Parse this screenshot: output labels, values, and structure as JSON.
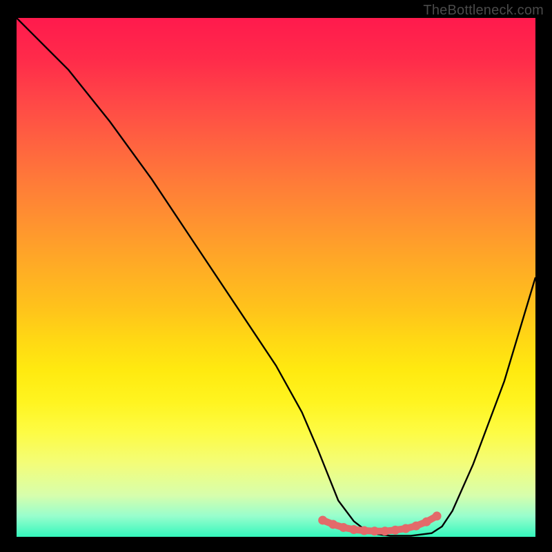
{
  "attribution": "TheBottleneck.com",
  "chart_data": {
    "type": "line",
    "title": "",
    "xlabel": "",
    "ylabel": "",
    "xlim": [
      0,
      100
    ],
    "ylim": [
      0,
      100
    ],
    "series": [
      {
        "name": "bottleneck-curve",
        "x": [
          0,
          3,
          6,
          10,
          18,
          26,
          34,
          42,
          50,
          55,
          58,
          60,
          62,
          65,
          68,
          72,
          76,
          80,
          82,
          84,
          88,
          94,
          100
        ],
        "y": [
          100,
          97,
          94,
          90,
          80,
          69,
          57,
          45,
          33,
          24,
          17,
          12,
          7,
          3,
          0.7,
          0.2,
          0.2,
          0.7,
          2,
          5,
          14,
          30,
          50
        ]
      },
      {
        "name": "marker-band",
        "x": [
          59,
          61,
          63,
          65,
          67,
          69,
          71,
          73,
          75,
          77,
          79,
          81
        ],
        "y": [
          3.2,
          2.4,
          1.8,
          1.4,
          1.2,
          1.1,
          1.1,
          1.3,
          1.6,
          2.1,
          2.9,
          4.0
        ]
      }
    ],
    "colors": {
      "curve": "#000000",
      "markers": "#e36a6a",
      "gradient_top": "#ff1a4d",
      "gradient_bottom": "#34f7bc",
      "background": "#000000"
    }
  }
}
